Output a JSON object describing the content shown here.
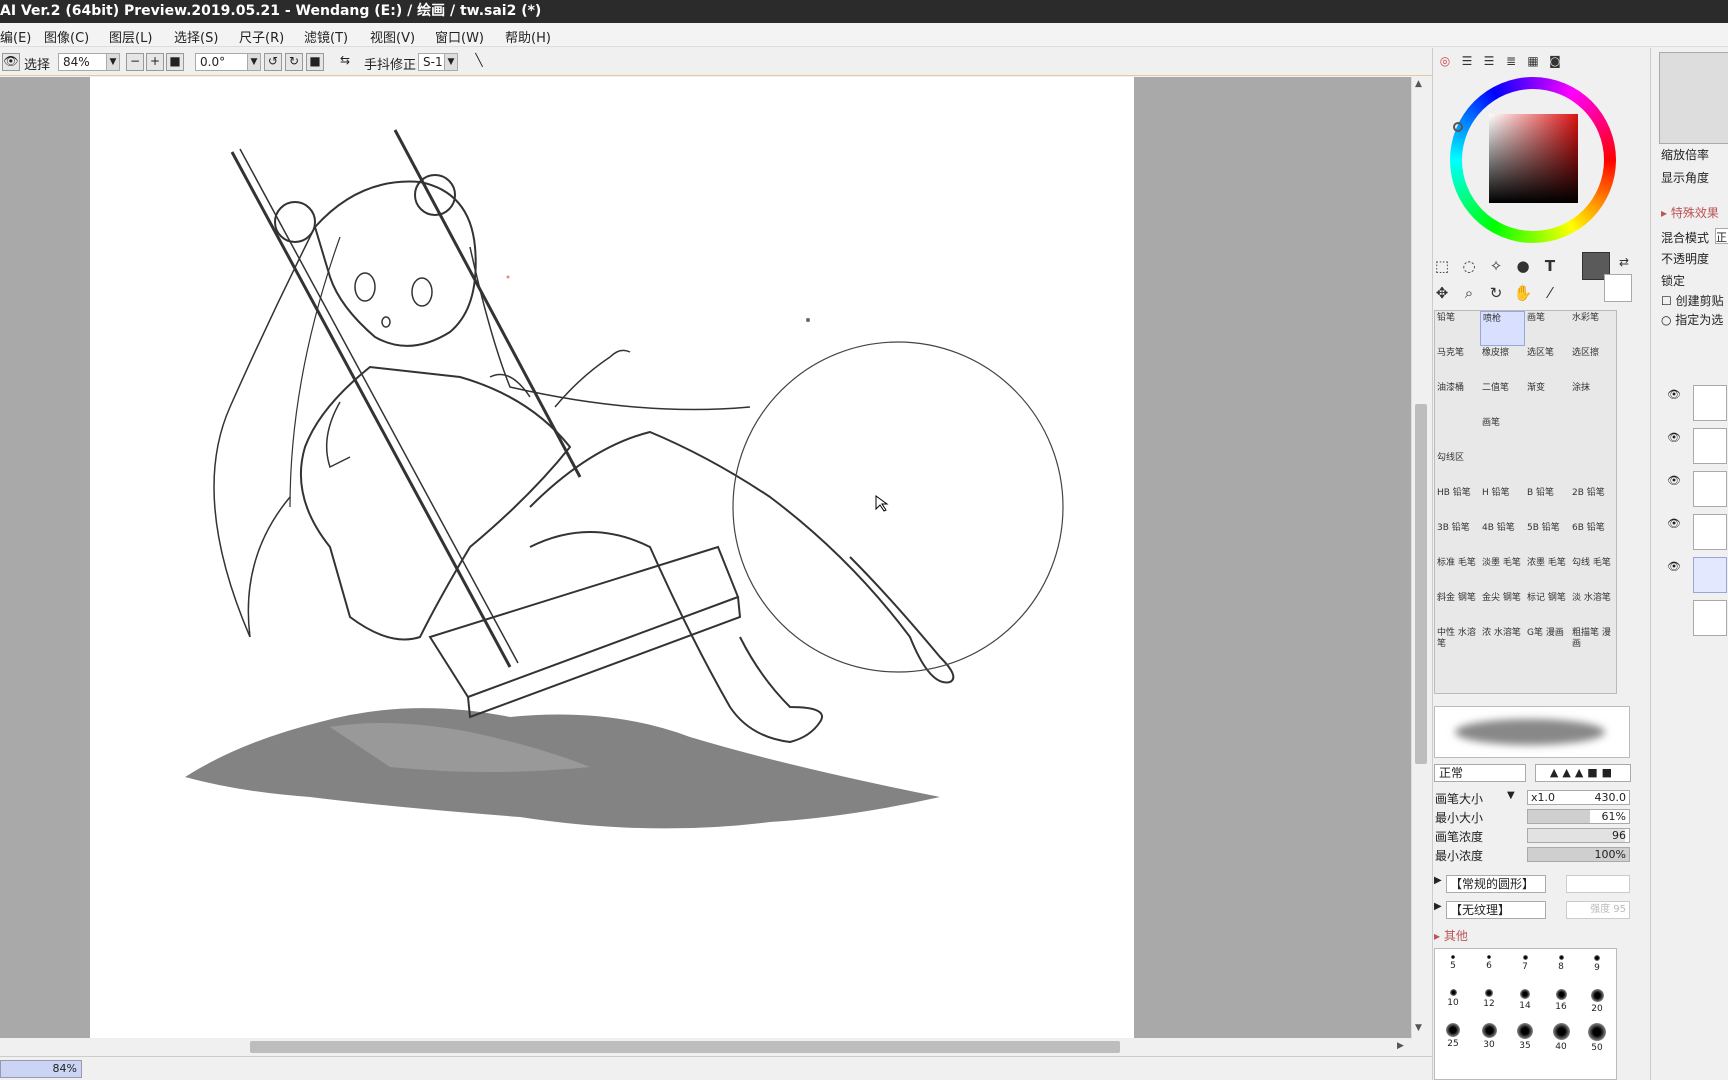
{
  "window": {
    "title": "AI Ver.2 (64bit) Preview.2019.05.21 - Wendang (E:) / 绘画 / tw.sai2 (*)"
  },
  "menu": [
    "编(E)",
    "图像(C)",
    "图层(L)",
    "选择(S)",
    "尺子(R)",
    "滤镜(T)",
    "视图(V)",
    "窗口(W)",
    "帮助(H)"
  ],
  "toolbar": {
    "select_label": "选择",
    "zoom_value": "84%",
    "angle_value": "0.0°",
    "stabilizer_label": "手抖修正",
    "stabilizer_value": "S-1"
  },
  "status": {
    "zoom": "84%"
  },
  "tools": {
    "brushes": [
      [
        "铅笔",
        "喷枪",
        "画笔",
        "水彩笔"
      ],
      [
        "马克笔",
        "橡皮擦",
        "选区笔",
        "选区擦"
      ],
      [
        "油漆桶",
        "二值笔",
        "渐变",
        "涂抹"
      ],
      [
        "",
        "画笔",
        "",
        ""
      ],
      [
        "勾线区",
        "",
        "",
        ""
      ],
      [
        "HB 铅笔",
        "H 铅笔",
        "B 铅笔",
        "2B 铅笔"
      ],
      [
        "3B 铅笔",
        "4B 铅笔",
        "5B 铅笔",
        "6B 铅笔"
      ],
      [
        "标准 毛笔",
        "淡墨 毛笔",
        "浓墨 毛笔",
        "勾线 毛笔"
      ],
      [
        "斜金 钢笔",
        "金尖 钢笔",
        "标记 钢笔",
        "淡 水溶笔"
      ],
      [
        "中性 水溶笔",
        "浓 水溶笔",
        "G笔 漫画",
        "粗描笔 漫画"
      ]
    ],
    "blend_mode": "正常",
    "brush_size_label": "画笔大小",
    "brush_size_mult": "x1.0",
    "brush_size_value": "430.0",
    "min_size_label": "最小大小",
    "min_size_value": "61%",
    "density_label": "画笔浓度",
    "density_value": "96",
    "min_density_label": "最小浓度",
    "min_density_value": "100%",
    "shape_label": "【常规的圆形】",
    "texture_label": "【无纹理】",
    "texture_value": "强度 95",
    "other_label": "其他",
    "dot_sizes": [
      "5",
      "6",
      "7",
      "8",
      "9",
      "10",
      "12",
      "14",
      "16",
      "20",
      "25",
      "30",
      "35",
      "40",
      "50"
    ]
  },
  "layers_panel": {
    "zoom_label": "缩放倍率",
    "angle_label": "显示角度",
    "effects_label": "特殊效果",
    "blend_label": "混合模式",
    "blend_value": "正",
    "opacity_label": "不透明度",
    "lock_label": "锁定",
    "clip_label": "创建剪贴",
    "select_source_label": "指定为选"
  },
  "colors": {
    "accent": "#4a6cd4",
    "current_color": "#5a5a5a"
  }
}
